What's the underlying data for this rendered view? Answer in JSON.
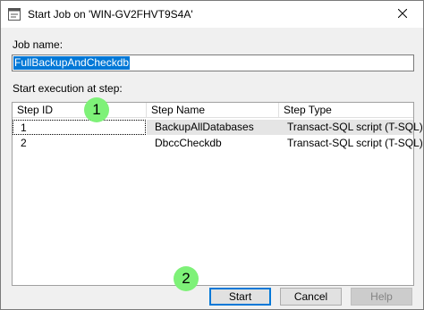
{
  "window": {
    "title": "Start Job on 'WIN-GV2FHVT9S4A'"
  },
  "job_name": {
    "label": "Job name:",
    "value": "FullBackupAndCheckdb"
  },
  "steps": {
    "label": "Start execution at step:",
    "columns": [
      "Step ID",
      "Step Name",
      "Step Type"
    ],
    "rows": [
      {
        "id": "1",
        "name": "BackupAllDatabases",
        "type": "Transact-SQL script (T-SQL)",
        "selected": true
      },
      {
        "id": "2",
        "name": "DbccCheckdb",
        "type": "Transact-SQL script (T-SQL)",
        "selected": false
      }
    ]
  },
  "callouts": [
    "1",
    "2"
  ],
  "buttons": {
    "start": "Start",
    "cancel": "Cancel",
    "help": "Help"
  },
  "colors": {
    "accent": "#0078d7",
    "callout": "#7ef178",
    "selection": "#e5e5e5"
  }
}
